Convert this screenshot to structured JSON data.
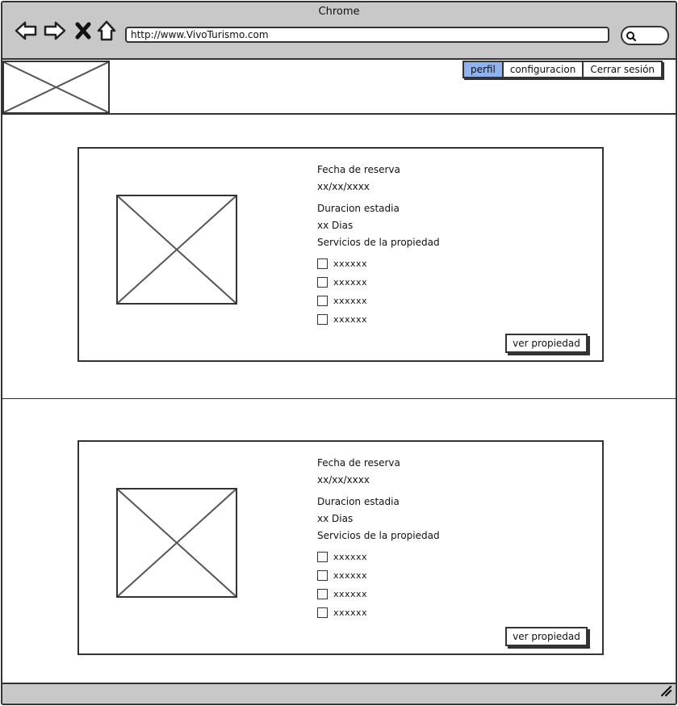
{
  "browser": {
    "title": "Chrome",
    "url": "http://www.VivoTurismo.com",
    "icons": [
      "back-arrow-icon",
      "forward-arrow-icon",
      "close-x-icon",
      "home-icon",
      "search-icon"
    ]
  },
  "header": {
    "logo": "image-placeholder",
    "tabs": [
      {
        "label": "perfil",
        "active": true
      },
      {
        "label": "configuracion",
        "active": false
      },
      {
        "label": "Cerrar sesión",
        "active": false
      }
    ]
  },
  "reservations": [
    {
      "fecha_label": "Fecha de reserva",
      "fecha_value": "xx/xx/xxxx",
      "duracion_label": "Duracion estadia",
      "duracion_value": "xx Dias",
      "servicios_label": "Servicios de la propiedad",
      "servicios": [
        "xxxxxx",
        "xxxxxx",
        "xxxxxx",
        "xxxxxx"
      ],
      "button_label": "ver propiedad"
    },
    {
      "fecha_label": "Fecha de reserva",
      "fecha_value": "xx/xx/xxxx",
      "duracion_label": "Duracion estadia",
      "duracion_value": "xx Dias",
      "servicios_label": "Servicios de la propiedad",
      "servicios": [
        "xxxxxx",
        "xxxxxx",
        "xxxxxx",
        "xxxxxx"
      ],
      "button_label": "ver propiedad"
    }
  ],
  "colors": {
    "chrome": "#c8c8c8",
    "active_tab": "#8fb3ee",
    "stroke": "#333333"
  }
}
